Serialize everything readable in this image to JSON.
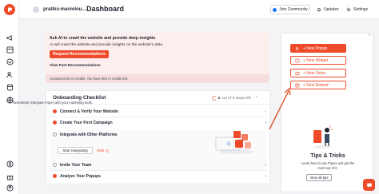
{
  "header": {
    "site_name": "pratiks-marvelou...",
    "page_title": "Dashboard",
    "join_community": "Join Community",
    "updates": "Updates",
    "settings": "Settings"
  },
  "ai_card": {
    "title": "Ask AI to crawl the website and provide deep insights",
    "subtitle": "AI will crawl the website and provide insights on the website's data.",
    "button": "Request Recommendations",
    "link": "View Past Recommendations",
    "credits": "Consumes 50 AI credits. You have 500 AI credits left."
  },
  "onboarding": {
    "title": "Onboarding Checklist",
    "progress_done": "2",
    "progress_rest": "out of 5 steps left",
    "steps": [
      {
        "label": "Connect & Verify Your Website",
        "state": "done"
      },
      {
        "label": "Create Your First Campaign",
        "state": "done"
      },
      {
        "label": "Integrate with Other Platforms",
        "state": "open"
      },
      {
        "label": "Invite Your Team",
        "state": "open"
      },
      {
        "label": "Analyze Your Popups",
        "state": "done"
      }
    ],
    "expanded_desc": "Seamlessly integrate Poper with your marketing tools.",
    "start_button": "Start Integrating",
    "help_link": "Help"
  },
  "right_panel": {
    "buttons": [
      {
        "label": "+ New Popup",
        "icon": "popup-icon",
        "primary": true
      },
      {
        "label": "+ New Widget",
        "icon": "widget-icon",
        "primary": false
      },
      {
        "label": "+ New Video",
        "icon": "video-icon",
        "primary": false
      },
      {
        "label": "+ New Embed",
        "icon": "embed-icon",
        "primary": false
      }
    ],
    "tips_title": "Tips & Tricks",
    "tips_desc_1": "Learn how to use Poper and get the",
    "tips_desc_2": "most out of it.",
    "tips_button": "View all tips"
  },
  "colors": {
    "brand": "#ef4b2b",
    "ai_card_bg": "#fdeeee"
  }
}
